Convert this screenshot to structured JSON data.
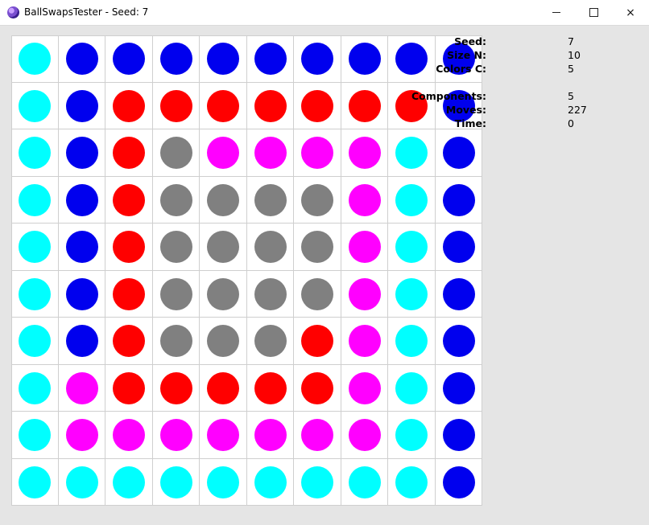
{
  "window": {
    "title": "BallSwapsTester - Seed: 7",
    "controls": {
      "minimize": "minimize",
      "maximize": "maximize",
      "close": "×"
    }
  },
  "info": {
    "seed_label": "Seed:",
    "seed": "7",
    "size_label": "Size N:",
    "size": "10",
    "colors_label": "Colors C:",
    "colors": "5",
    "components_label": "Components:",
    "components": "5",
    "moves_label": "Moves:",
    "moves": "227",
    "time_label": "Time:",
    "time": "0"
  },
  "palette": {
    "C": "#00ffff",
    "B": "#0000ee",
    "R": "#ff0000",
    "G": "#808080",
    "M": "#ff00ff"
  },
  "grid": [
    "CBBBBBBBBB",
    "CBRRRRRRRB",
    "CBRGMMMMCB",
    "CBRGGGGMCB",
    "CBRGGGGMCB",
    "CBRGGGGMCB",
    "CBRGGGRMCB",
    "CMRRRRRMCB",
    "CMMMMMMMCB",
    "CCCCCCCCCB"
  ]
}
